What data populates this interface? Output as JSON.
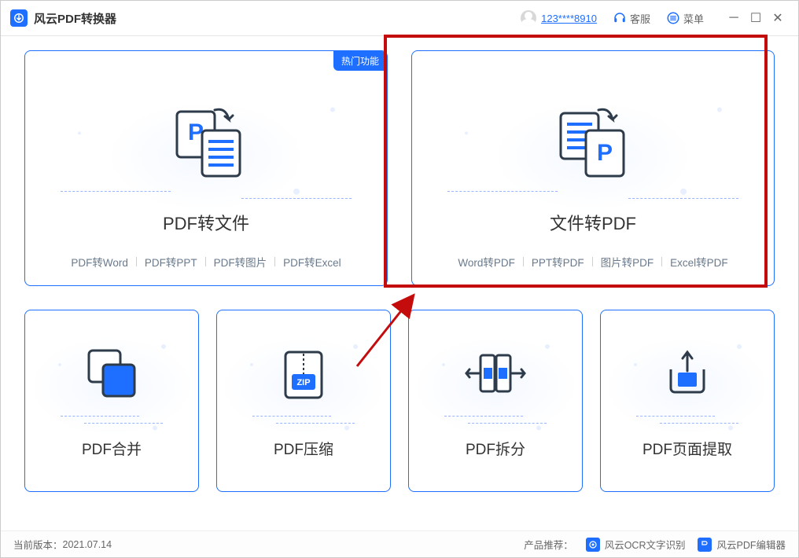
{
  "app": {
    "title": "风云PDF转换器"
  },
  "titlebar": {
    "user": "123****8910",
    "kefu": "客服",
    "menu": "菜单"
  },
  "cards": {
    "hot_badge": "热门功能",
    "pdf_to_file": {
      "title": "PDF转文件",
      "s1": "PDF转Word",
      "s2": "PDF转PPT",
      "s3": "PDF转图片",
      "s4": "PDF转Excel"
    },
    "file_to_pdf": {
      "title": "文件转PDF",
      "s1": "Word转PDF",
      "s2": "PPT转PDF",
      "s3": "图片转PDF",
      "s4": "Excel转PDF"
    },
    "merge": {
      "title": "PDF合并"
    },
    "compress": {
      "title": "PDF压缩"
    },
    "split": {
      "title": "PDF拆分"
    },
    "extract": {
      "title": "PDF页面提取"
    }
  },
  "footer": {
    "version_label": "当前版本：",
    "version": "2021.07.14",
    "rec_label": "产品推荐：",
    "rec1": "风云OCR文字识别",
    "rec2": "风云PDF编辑器"
  }
}
